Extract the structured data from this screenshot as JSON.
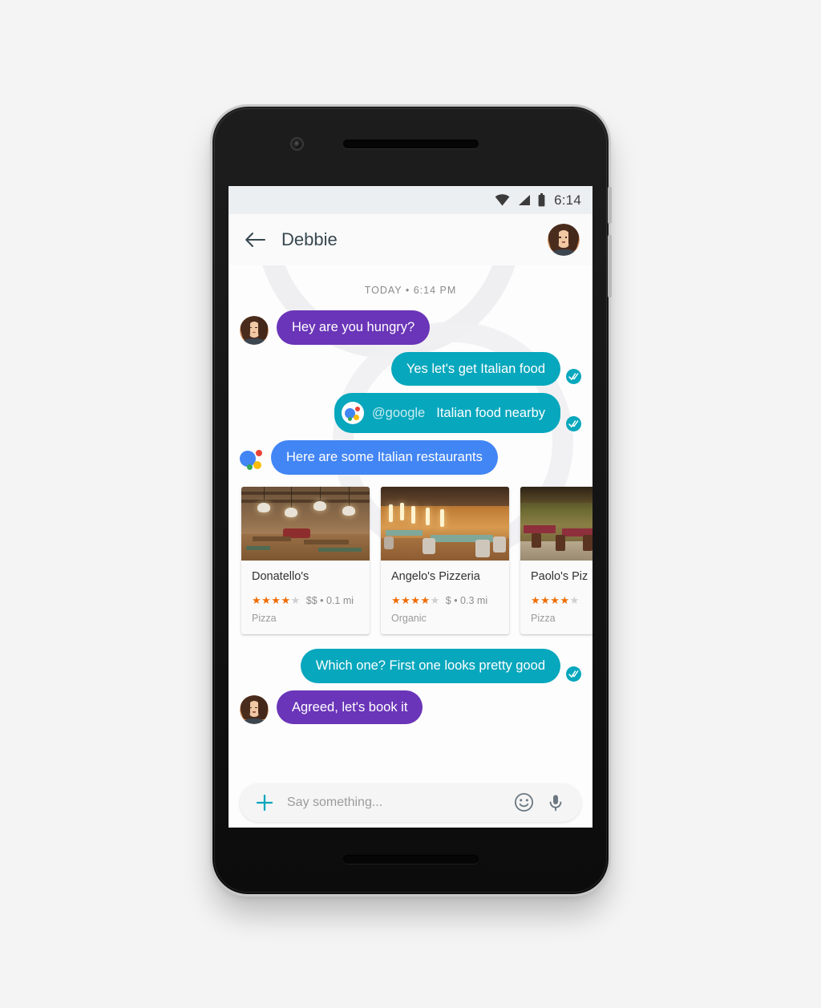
{
  "status_bar": {
    "time": "6:14",
    "icons": [
      "wifi-icon",
      "cellular-signal-icon",
      "battery-icon"
    ]
  },
  "app_bar": {
    "back_icon": "back-arrow-icon",
    "title": "Debbie",
    "profile_avatar": "contact-avatar"
  },
  "chat": {
    "day_divider": "TODAY • 6:14 PM",
    "messages": [
      {
        "id": "m1",
        "direction": "incoming",
        "style": "purple",
        "text": "Hey are you hungry?",
        "avatar": true,
        "read_receipt": false
      },
      {
        "id": "m2",
        "direction": "outgoing",
        "style": "teal",
        "text": "Yes let's get Italian food",
        "avatar": false,
        "read_receipt": true
      },
      {
        "id": "m3",
        "direction": "outgoing",
        "style": "teal",
        "mention": "@google",
        "text": "Italian food nearby",
        "avatar": false,
        "read_receipt": true,
        "assistant_logo": true
      },
      {
        "id": "m4",
        "direction": "incoming",
        "style": "blue",
        "text": "Here are some Italian restaurants",
        "avatar": false,
        "read_receipt": false,
        "assistant_logo_large": true
      },
      {
        "id": "m5",
        "direction": "outgoing",
        "style": "teal",
        "text": "Which one? First one looks pretty good",
        "avatar": false,
        "read_receipt": true
      },
      {
        "id": "m6",
        "direction": "incoming",
        "style": "purple",
        "text": "Agreed, let's book it",
        "avatar": true,
        "read_receipt": false
      }
    ]
  },
  "restaurants": [
    {
      "name": "Donatello's",
      "rating": 4,
      "rating_max": 5,
      "price": "$$",
      "distance": "0.1 mi",
      "price_distance": "$$ • 0.1 mi",
      "category": "Pizza",
      "image": "rustic-restaurant-interior"
    },
    {
      "name": "Angelo's Pizzeria",
      "rating": 4,
      "rating_max": 5,
      "price": "$",
      "distance": "0.3 mi",
      "price_distance": "$ • 0.3 mi",
      "category": "Organic",
      "image": "warm-lit-restaurant-interior"
    },
    {
      "name": "Paolo's Pizzeria",
      "name_truncated": "Paolo's Piz",
      "rating": 4,
      "rating_max": 5,
      "price": "",
      "distance": "",
      "price_distance": "",
      "category": "Pizza",
      "image": "green-toned-restaurant-interior"
    }
  ],
  "composer": {
    "add_icon": "plus-icon",
    "placeholder": "Say something...",
    "value": "",
    "emoji_icon": "emoji-smiley-icon",
    "mic_icon": "microphone-icon"
  },
  "nav_bar": {
    "back": "triangle-back-icon",
    "home": "circle-home-icon",
    "recents": "square-recents-icon"
  },
  "colors": {
    "bubble_purple": "#6a35b8",
    "bubble_teal": "#07a7bd",
    "bubble_blue": "#4285f4",
    "accent_teal": "#07a7bd",
    "star_on": "#ef6c00",
    "star_off": "#cfcfcf",
    "page_background": "#f4f4f4",
    "status_bar": "#eceff1",
    "app_bar": "#fafafa"
  }
}
